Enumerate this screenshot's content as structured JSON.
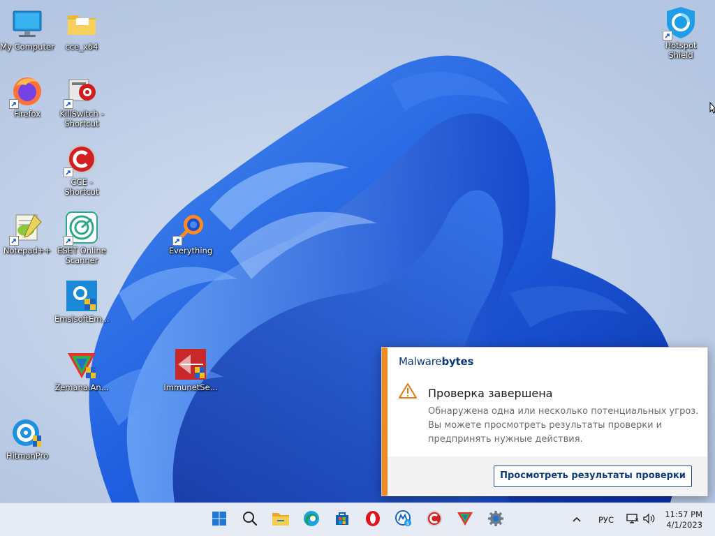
{
  "desktop_icons": [
    {
      "label": "My Computer",
      "icon": "computer-icon"
    },
    {
      "label": "cce_x64",
      "icon": "folder-icon"
    },
    {
      "label": "Hotspot Shield",
      "icon": "hotspot-shield-icon"
    },
    {
      "label": "Firefox",
      "icon": "firefox-icon"
    },
    {
      "label": "KillSwitch - Shortcut",
      "icon": "killswitch-icon"
    },
    {
      "label": "CCE - Shortcut",
      "icon": "comodo-cleaning-icon"
    },
    {
      "label": "Notepad++",
      "icon": "notepadpp-icon"
    },
    {
      "label": "ESET Online Scanner",
      "icon": "eset-icon"
    },
    {
      "label": "Everything",
      "icon": "everything-search-icon"
    },
    {
      "label": "EmsisoftEm...",
      "icon": "emsisoft-icon"
    },
    {
      "label": "Zemana.An...",
      "icon": "zemana-icon"
    },
    {
      "label": "ImmunetSe...",
      "icon": "immunet-icon"
    },
    {
      "label": "HitmanPro",
      "icon": "hitmanpro-icon"
    }
  ],
  "notification": {
    "brand_light": "Malware",
    "brand_bold": "bytes",
    "title": "Проверка завершена",
    "message": "Обнаружена одна или несколько потенциальных угроз. Вы можете просмотреть результаты проверки и предпринять нужные действия.",
    "button": "Просмотреть результаты проверки",
    "accent_color": "#f08c1f",
    "brand_color": "#0d3b7a"
  },
  "taskbar": {
    "apps": [
      "start-icon",
      "search-icon",
      "file-explorer-icon",
      "edge-icon",
      "store-icon",
      "opera-icon",
      "malwarebytes-icon",
      "comodo-icon",
      "zemana-icon",
      "settings-icon"
    ],
    "tray": {
      "chevron": "show-hidden-icons",
      "language": "РУС",
      "network_icon": "network-icon",
      "volume_icon": "volume-icon",
      "time": "11:57 PM",
      "date": "4/1/2023"
    }
  }
}
